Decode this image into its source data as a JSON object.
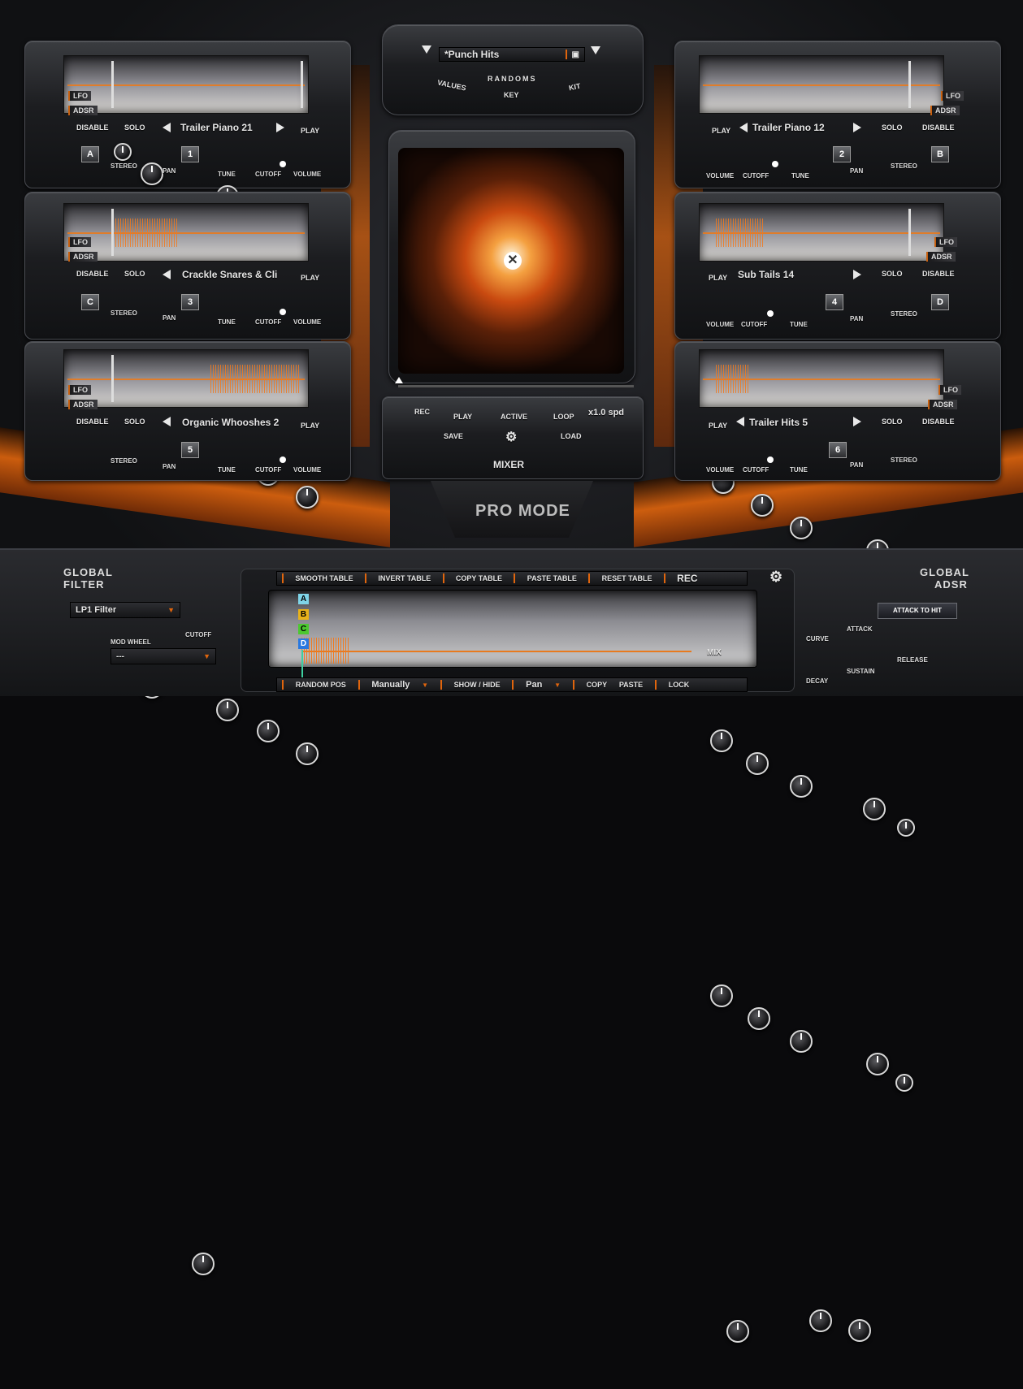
{
  "preset": {
    "name": "*Punch Hits",
    "values": "VALUES",
    "randoms": "RANDOMS",
    "key": "KEY",
    "kit": "KIT"
  },
  "common": {
    "lfo": "LFO",
    "adsr": "ADSR",
    "disable": "DISABLE",
    "solo": "SOLO",
    "play": "PLAY",
    "stereo": "STEREO",
    "pan": "PAN",
    "tune": "TUNE",
    "cutoff": "CUTOFF",
    "volume": "VOLUME"
  },
  "slots": {
    "a": {
      "name": "Trailer Piano 21",
      "letter": "A",
      "number": "1"
    },
    "b": {
      "name": "Trailer Piano 12",
      "letter": "B",
      "number": "2"
    },
    "c": {
      "name": "Crackle Snares & Cli",
      "letter": "C",
      "number": "3"
    },
    "d": {
      "name": "Sub Tails 14",
      "letter": "D",
      "number": "4"
    },
    "e": {
      "name": "Organic Whooshes 2",
      "number": "5"
    },
    "f": {
      "name": "Trailer Hits 5",
      "number": "6"
    }
  },
  "transport": {
    "rec": "REC",
    "play": "PLAY",
    "active": "ACTIVE",
    "loop": "LOOP",
    "speed": "x1.0 spd",
    "save": "SAVE",
    "load": "LOAD",
    "mixer": "MIXER",
    "mode": "PRO MODE"
  },
  "global_filter": {
    "title_1": "GLOBAL",
    "title_2": "FILTER",
    "filter_type": "LP1 Filter",
    "cutoff": "CUTOFF",
    "mod_wheel": "MOD WHEEL",
    "mod_value": "---"
  },
  "table": {
    "smooth": "SMOOTH TABLE",
    "invert": "INVERT TABLE",
    "copy": "COPY TABLE",
    "paste": "PASTE TABLE",
    "reset": "RESET TABLE",
    "rec": "REC",
    "lanes": [
      "A",
      "B",
      "C",
      "D"
    ],
    "mix": "MIX",
    "random_pos": "RANDOM POS",
    "mode": "Manually",
    "show_hide": "SHOW / HIDE",
    "param": "Pan",
    "copy2": "COPY",
    "paste2": "PASTE",
    "lock": "LOCK"
  },
  "global_adsr": {
    "title_1": "GLOBAL",
    "title_2": "ADSR",
    "attack_to_hit": "ATTACK TO HIT",
    "curve": "CURVE",
    "attack": "ATTACK",
    "decay": "DECAY",
    "sustain": "SUSTAIN",
    "release": "RELEASE"
  },
  "colors": {
    "accent": "#e0650d",
    "lane_a": "#7fd4e8",
    "lane_b": "#e8b21a",
    "lane_c": "#4cc830",
    "lane_d": "#2878e0"
  }
}
